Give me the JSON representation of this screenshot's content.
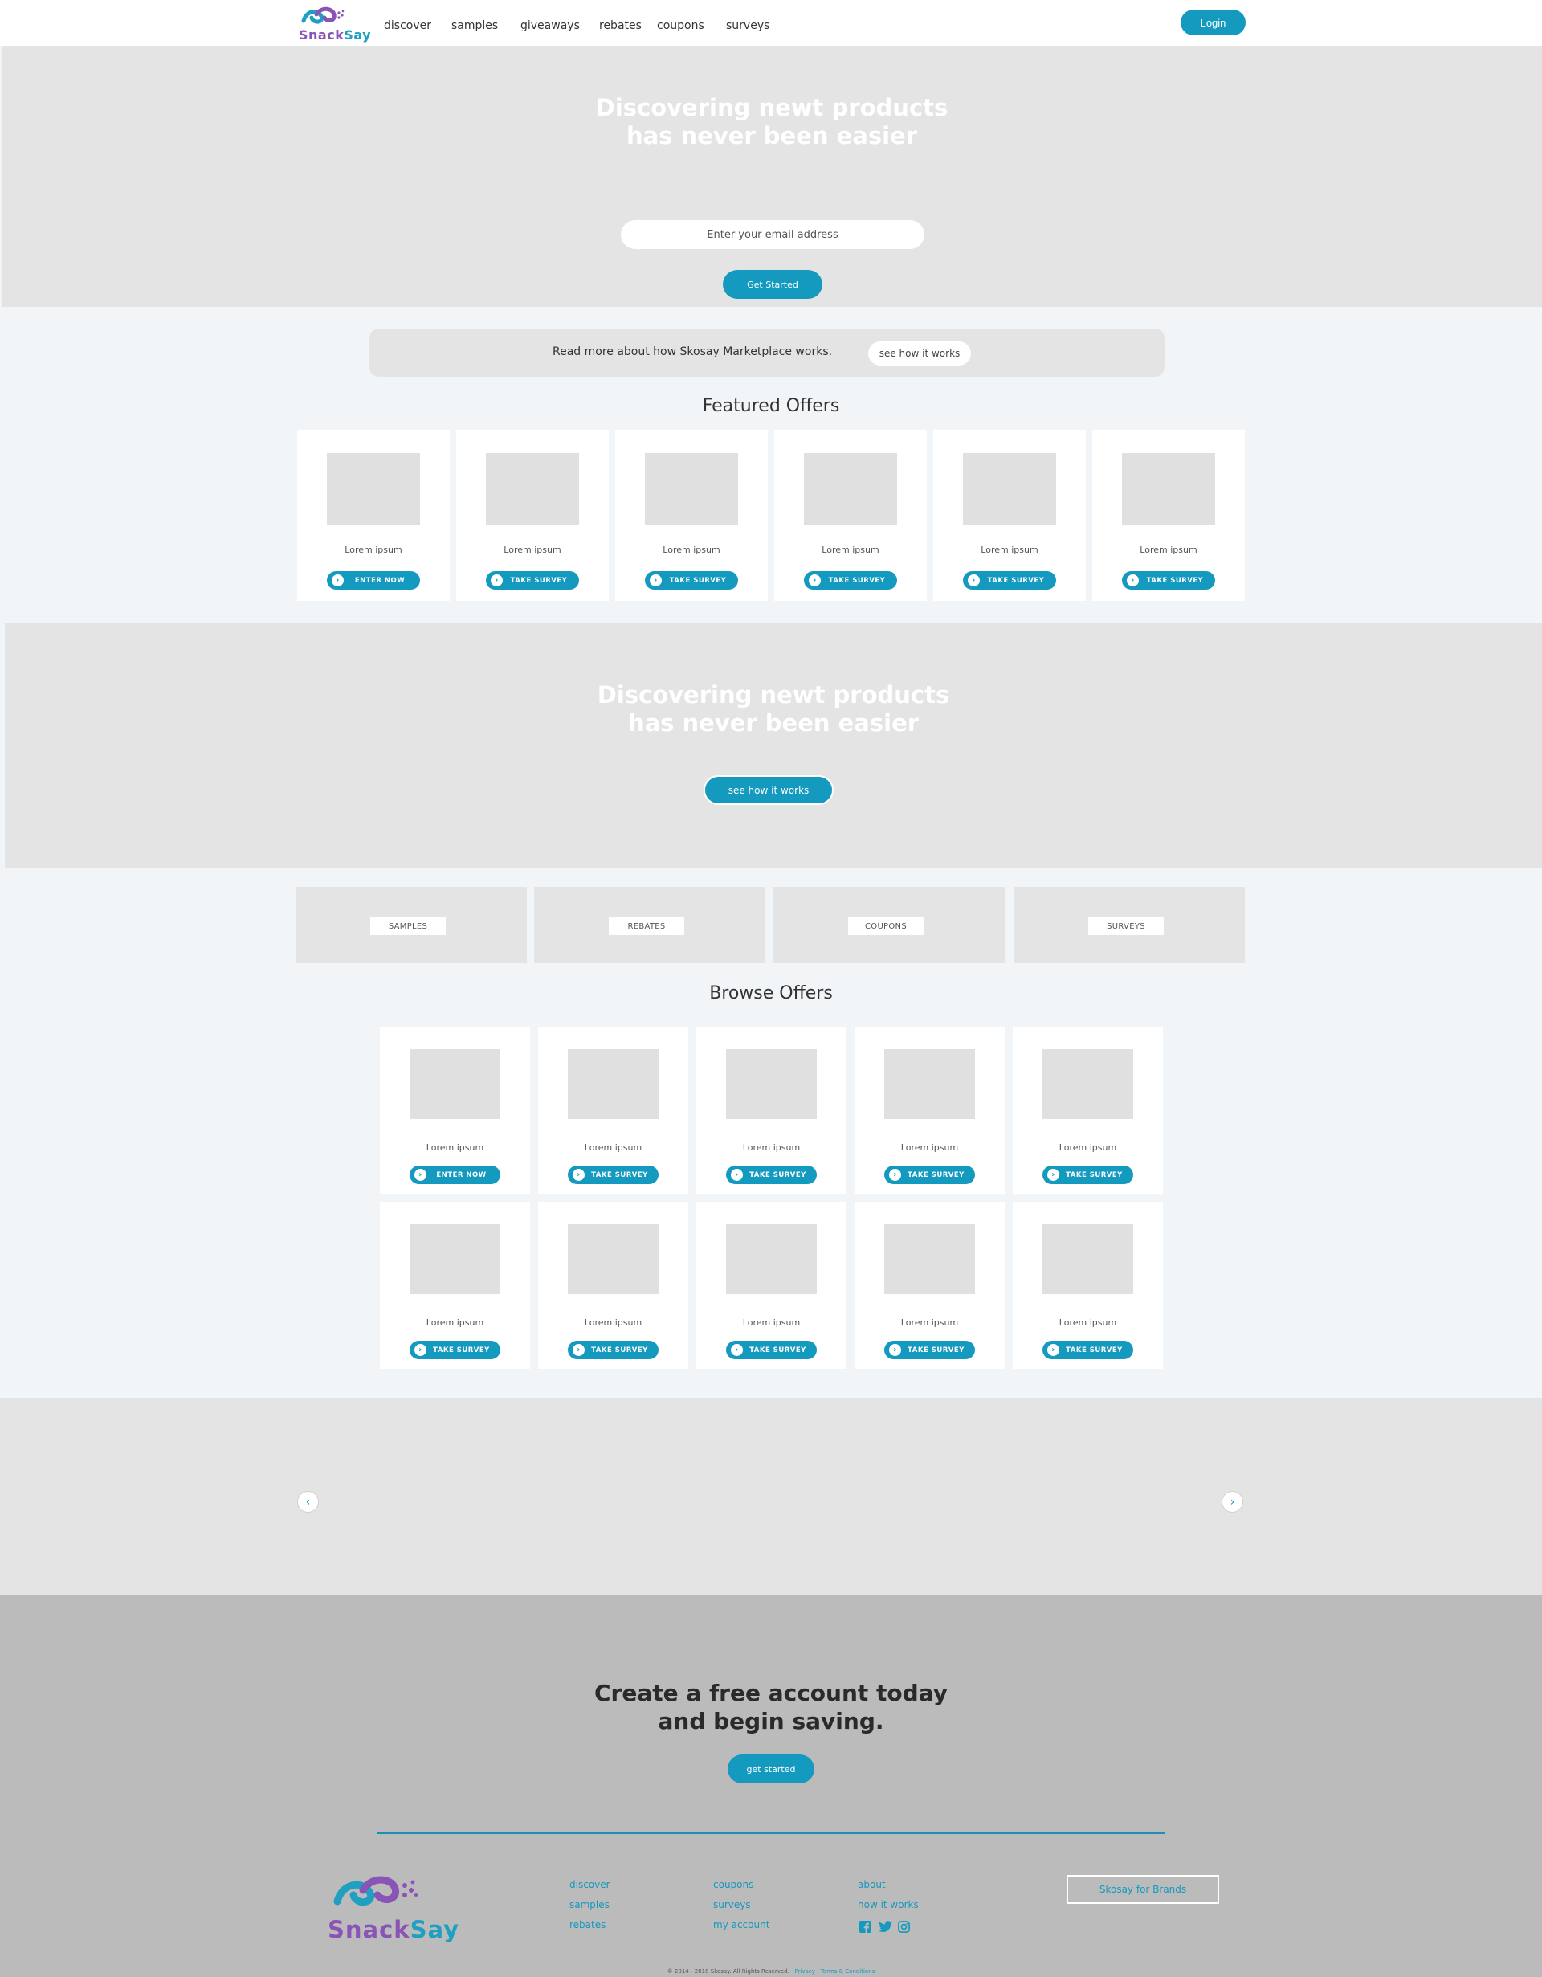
{
  "nav": {
    "logo_text_a": "Snack",
    "logo_text_b": "Say",
    "links": [
      "discover",
      "samples",
      "giveaways",
      "rebates",
      "coupons",
      "surveys"
    ],
    "login_label": "Login"
  },
  "hero": {
    "title_line1": "Discovering newt products",
    "title_line2": "has never been easier",
    "email_placeholder": "Enter your email address",
    "cta_label": "Get Started"
  },
  "info_bar": {
    "text": "Read more about how Skosay Marketplace works.",
    "button_label": "see how it works"
  },
  "featured": {
    "title": "Featured Offers",
    "cards": [
      {
        "label": "Lorem ipsum",
        "button": "ENTER NOW"
      },
      {
        "label": "Lorem ipsum",
        "button": "TAKE SURVEY"
      },
      {
        "label": "Lorem ipsum",
        "button": "TAKE SURVEY"
      },
      {
        "label": "Lorem ipsum",
        "button": "TAKE SURVEY"
      },
      {
        "label": "Lorem ipsum",
        "button": "TAKE SURVEY"
      },
      {
        "label": "Lorem ipsum",
        "button": "TAKE SURVEY"
      }
    ]
  },
  "hero2": {
    "title_line1": "Discovering newt products",
    "title_line2": "has never been easier",
    "button_label": "see how it works"
  },
  "categories": [
    "SAMPLES",
    "REBATES",
    "COUPONS",
    "SURVEYS"
  ],
  "browse": {
    "title": "Browse Offers",
    "cards": [
      {
        "label": "Lorem ipsum",
        "button": "ENTER NOW"
      },
      {
        "label": "Lorem ipsum",
        "button": "TAKE SURVEY"
      },
      {
        "label": "Lorem ipsum",
        "button": "TAKE SURVEY"
      },
      {
        "label": "Lorem ipsum",
        "button": "TAKE SURVEY"
      },
      {
        "label": "Lorem ipsum",
        "button": "TAKE SURVEY"
      },
      {
        "label": "Lorem ipsum",
        "button": "TAKE SURVEY"
      },
      {
        "label": "Lorem ipsum",
        "button": "TAKE SURVEY"
      },
      {
        "label": "Lorem ipsum",
        "button": "TAKE SURVEY"
      },
      {
        "label": "Lorem ipsum",
        "button": "TAKE SURVEY"
      },
      {
        "label": "Lorem ipsum",
        "button": "TAKE SURVEY"
      }
    ]
  },
  "carousel": {
    "prev_icon": "chevron-left-icon",
    "next_icon": "chevron-right-icon"
  },
  "cta": {
    "title_line1": "Create a free account today",
    "title_line2": "and begin saving.",
    "button_label": "get started"
  },
  "footer": {
    "logo_text_a": "Snack",
    "logo_text_b": "Say",
    "col1": [
      "discover",
      "samples",
      "rebates"
    ],
    "col2": [
      "coupons",
      "surveys",
      "my account"
    ],
    "col3": [
      "about",
      "how it works"
    ],
    "social_icons": [
      "facebook-icon",
      "twitter-icon",
      "instagram-icon"
    ],
    "brands_label": "Skosay for Brands",
    "copyright": "© 2014 - 2018 Skosay. All Rights Reserved.",
    "privacy": "Privacy",
    "sep": "|",
    "terms": "Terms & Conditions"
  },
  "colors": {
    "accent": "#1499bf",
    "purple": "#8a54b6",
    "placeholder_gray": "#e4e4e4",
    "footer_gray": "#bbbbbb"
  }
}
